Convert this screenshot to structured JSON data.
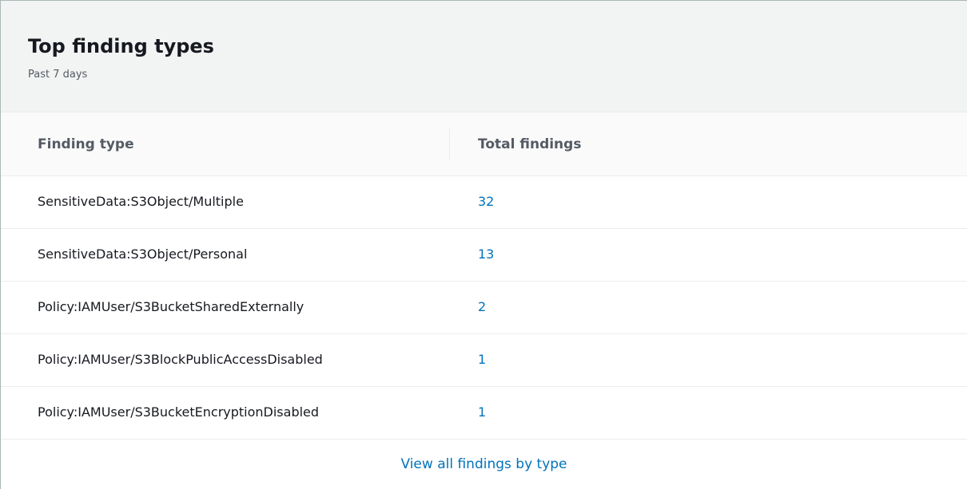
{
  "panel": {
    "title": "Top finding types",
    "subtitle": "Past 7 days"
  },
  "table": {
    "columns": [
      "Finding type",
      "Total findings"
    ],
    "rows": [
      {
        "type": "SensitiveData:S3Object/Multiple",
        "total": "32"
      },
      {
        "type": "SensitiveData:S3Object/Personal",
        "total": "13"
      },
      {
        "type": "Policy:IAMUser/S3BucketSharedExternally",
        "total": "2"
      },
      {
        "type": "Policy:IAMUser/S3BlockPublicAccessDisabled",
        "total": "1"
      },
      {
        "type": "Policy:IAMUser/S3BucketEncryptionDisabled",
        "total": "1"
      }
    ]
  },
  "footer": {
    "link_label": "View all findings by type"
  },
  "colors": {
    "link": "#0073bb",
    "header_bg": "#f2f3f3",
    "text": "#16191f"
  }
}
